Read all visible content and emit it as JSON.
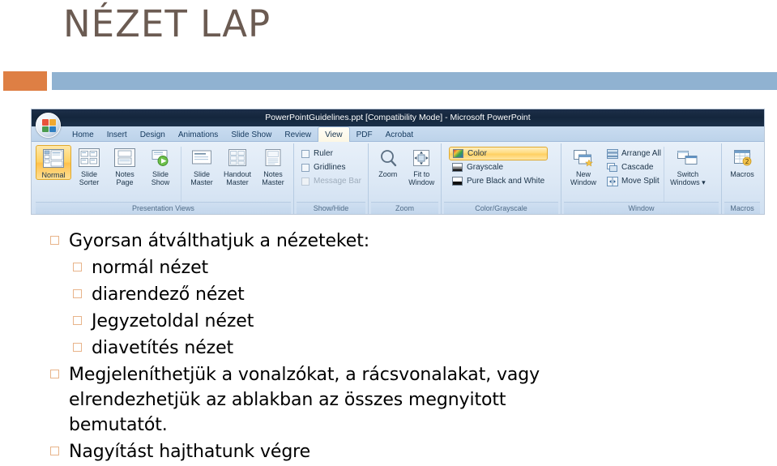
{
  "slide": {
    "title": "NÉZET LAP",
    "accent_orange": "#DE7F44",
    "accent_blue": "#90B2D1",
    "title_color": "#6B5B52",
    "bullet_color": "#E8B48A"
  },
  "ribbon": {
    "titlebar": "PowerPointGuidelines.ppt [Compatibility Mode] - Microsoft PowerPoint",
    "office_button": "office-orb-icon",
    "tabs": [
      {
        "label": "Home",
        "active": false
      },
      {
        "label": "Insert",
        "active": false
      },
      {
        "label": "Design",
        "active": false
      },
      {
        "label": "Animations",
        "active": false
      },
      {
        "label": "Slide Show",
        "active": false
      },
      {
        "label": "Review",
        "active": false
      },
      {
        "label": "View",
        "active": true
      },
      {
        "label": "PDF",
        "active": false
      },
      {
        "label": "Acrobat",
        "active": false
      }
    ],
    "groups": {
      "presentation_views": {
        "label": "Presentation Views",
        "buttons": [
          {
            "line1": "Normal",
            "line2": "",
            "selected": true
          },
          {
            "line1": "Slide",
            "line2": "Sorter",
            "selected": false
          },
          {
            "line1": "Notes",
            "line2": "Page",
            "selected": false
          },
          {
            "line1": "Slide",
            "line2": "Show",
            "selected": false
          },
          {
            "line1": "Slide",
            "line2": "Master",
            "selected": false
          },
          {
            "line1": "Handout",
            "line2": "Master",
            "selected": false
          },
          {
            "line1": "Notes",
            "line2": "Master",
            "selected": false
          }
        ]
      },
      "show_hide": {
        "label": "Show/Hide",
        "items": [
          {
            "label": "Ruler",
            "checked": false,
            "disabled": false
          },
          {
            "label": "Gridlines",
            "checked": false,
            "disabled": false
          },
          {
            "label": "Message Bar",
            "checked": false,
            "disabled": true
          }
        ]
      },
      "zoom": {
        "label": "Zoom",
        "buttons": [
          {
            "line1": "Zoom",
            "line2": ""
          },
          {
            "line1": "Fit to",
            "line2": "Window"
          }
        ]
      },
      "color_grayscale": {
        "label": "Color/Grayscale",
        "items": [
          {
            "label": "Color",
            "selected": true
          },
          {
            "label": "Grayscale",
            "selected": false
          },
          {
            "label": "Pure Black and White",
            "selected": false
          }
        ]
      },
      "window": {
        "label": "Window",
        "new_window": {
          "line1": "New",
          "line2": "Window"
        },
        "items": [
          {
            "label": "Arrange All"
          },
          {
            "label": "Cascade"
          },
          {
            "label": "Move Split"
          }
        ],
        "switch_windows": {
          "line1": "Switch",
          "line2": "Windows ▾"
        }
      },
      "macros": {
        "label": "Macros",
        "button": {
          "line1": "Macros",
          "line2": ""
        }
      }
    }
  },
  "content": {
    "bullets": [
      {
        "level": 0,
        "text": "Gyorsan átválthatjuk a nézeteket:"
      },
      {
        "level": 1,
        "text": "normál nézet"
      },
      {
        "level": 1,
        "text": "diarendező nézet"
      },
      {
        "level": 1,
        "text": "Jegyzetoldal nézet"
      },
      {
        "level": 1,
        "text": "diavetítés nézet"
      },
      {
        "level": 0,
        "text": "Megjeleníthetjük a vonalzókat, a rácsvonalakat, vagy elrendezhetjük az ablakban az összes megnyitott bemutatót."
      },
      {
        "level": 0,
        "text": "Nagyítást hajthatunk végre"
      }
    ]
  }
}
